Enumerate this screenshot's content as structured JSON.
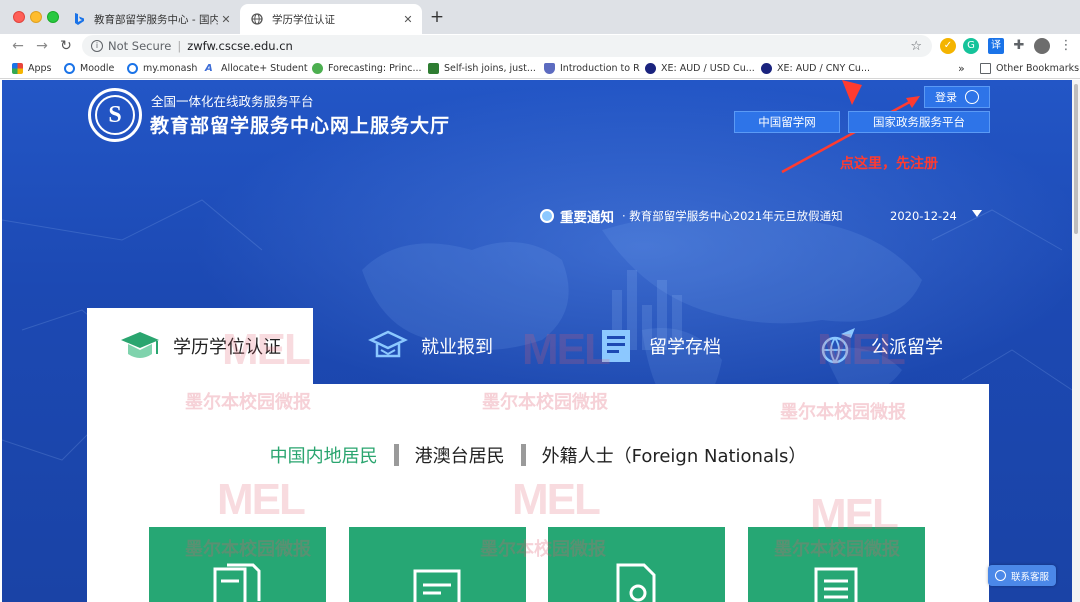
{
  "browser": {
    "tabs": [
      {
        "title": "教育部留学服务中心 - 国内版 Bi",
        "icon": "bing-icon"
      },
      {
        "title": "学历学位认证",
        "icon": "globe-icon"
      }
    ],
    "new_tab": "+",
    "address": {
      "security": "Not Secure",
      "url": "zwfw.cscse.edu.cn"
    },
    "bookmarks": [
      {
        "label": "Apps",
        "color": "#e8453c"
      },
      {
        "label": "Moodle",
        "color": "#1a73e8"
      },
      {
        "label": "my.monash",
        "color": "#1a73e8"
      },
      {
        "label": "Allocate+ Student",
        "color": "#3b6bd6"
      },
      {
        "label": "Forecasting: Princ...",
        "color": "#4caf50"
      },
      {
        "label": "Self-ish joins, just...",
        "color": "#2e7d32"
      },
      {
        "label": "Introduction to R",
        "color": "#5c6bc0"
      },
      {
        "label": "XE: AUD / USD Cu...",
        "color": "#1a237e"
      },
      {
        "label": "XE: AUD / CNY Cu...",
        "color": "#1a237e"
      }
    ],
    "bookmarks_more": "»",
    "other_bookmarks": "Other Bookmarks"
  },
  "site": {
    "logo_letter": "S",
    "subtitle": "全国一体化在线政务服务平台",
    "title": "教育部留学服务中心网上服务大厅",
    "login_label": "登录",
    "links": [
      "中国留学网",
      "国家政务服务平台"
    ],
    "annotation": "点这里，先注册"
  },
  "notice": {
    "label": "重要通知",
    "item": "· 教育部留学服务中心2021年元旦放假通知",
    "date": "2020-12-24"
  },
  "service_tabs": [
    {
      "label": "学历学位认证",
      "icon": "graduation-cap-icon",
      "active": true
    },
    {
      "label": "就业报到",
      "icon": "job-icon",
      "active": false
    },
    {
      "label": "留学存档",
      "icon": "archive-icon",
      "active": false
    },
    {
      "label": "公派留学",
      "icon": "plane-globe-icon",
      "active": false
    }
  ],
  "categories": [
    {
      "label": "中国内地居民",
      "active": true
    },
    {
      "label": "港澳台居民",
      "active": false
    },
    {
      "label": "外籍人士（Foreign Nationals）",
      "active": false
    }
  ],
  "cards": [
    {
      "icon": "documents-icon"
    },
    {
      "icon": "form-icon"
    },
    {
      "icon": "search-document-icon"
    },
    {
      "icon": "list-icon"
    }
  ],
  "customer_service": "联系客服",
  "watermark": {
    "logo": "MEL",
    "text": "墨尔本校园微报"
  },
  "colors": {
    "accent_green": "#26a774",
    "header_blue": "#1c49b3",
    "button_blue": "#2e74e8",
    "annotation_red": "#ff3b30"
  }
}
